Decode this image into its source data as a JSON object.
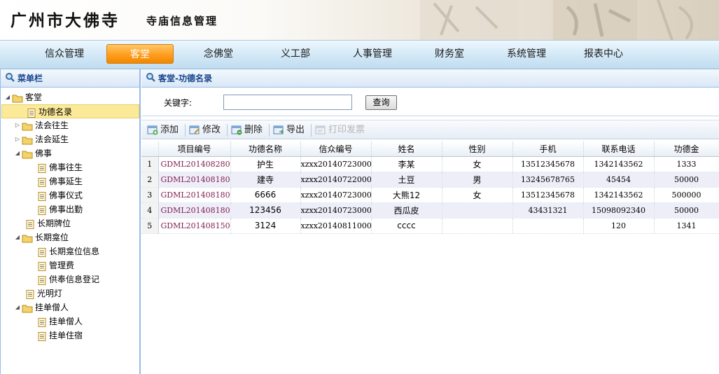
{
  "header": {
    "title": "广州市大佛寺",
    "subtitle": "寺庙信息管理"
  },
  "nav": {
    "items": [
      {
        "label": "信众管理",
        "active": false
      },
      {
        "label": "客堂",
        "active": true
      },
      {
        "label": "念佛堂",
        "active": false
      },
      {
        "label": "义工部",
        "active": false
      },
      {
        "label": "人事管理",
        "active": false
      },
      {
        "label": "财务室",
        "active": false
      },
      {
        "label": "系统管理",
        "active": false
      },
      {
        "label": "报表中心",
        "active": false
      }
    ]
  },
  "sidebar": {
    "title": "菜单栏",
    "tree": [
      {
        "label": "客堂",
        "type": "folder",
        "expanded": true,
        "level": 0
      },
      {
        "label": "功德名录",
        "type": "page",
        "level": 1,
        "selected": true
      },
      {
        "label": "法会往生",
        "type": "folder",
        "expanded": false,
        "level": 1
      },
      {
        "label": "法会延生",
        "type": "folder",
        "expanded": false,
        "level": 1
      },
      {
        "label": "佛事",
        "type": "folder",
        "expanded": true,
        "level": 1
      },
      {
        "label": "佛事往生",
        "type": "page",
        "level": 2
      },
      {
        "label": "佛事延生",
        "type": "page",
        "level": 2
      },
      {
        "label": "佛事仪式",
        "type": "page",
        "level": 2
      },
      {
        "label": "佛事出勤",
        "type": "page",
        "level": 2
      },
      {
        "label": "长期牌位",
        "type": "page",
        "level": 1
      },
      {
        "label": "长期龛位",
        "type": "folder",
        "expanded": true,
        "level": 1
      },
      {
        "label": "长期龛位信息",
        "type": "page",
        "level": 2
      },
      {
        "label": "管理费",
        "type": "page",
        "level": 2
      },
      {
        "label": "供奉信息登记",
        "type": "page",
        "level": 2
      },
      {
        "label": "光明灯",
        "type": "page",
        "level": 1
      },
      {
        "label": "挂单僧人",
        "type": "folder",
        "expanded": true,
        "level": 1
      },
      {
        "label": "挂单僧人",
        "type": "page",
        "level": 2
      },
      {
        "label": "挂单住宿",
        "type": "page",
        "level": 2
      }
    ]
  },
  "main": {
    "title": "客堂-功德名录",
    "search": {
      "label": "关键字:",
      "value": "",
      "button_label": "查询"
    },
    "toolbar": [
      {
        "label": "添加",
        "icon": "add-icon",
        "disabled": false
      },
      {
        "label": "修改",
        "icon": "edit-icon",
        "disabled": false
      },
      {
        "label": "删除",
        "icon": "delete-icon",
        "disabled": false
      },
      {
        "label": "导出",
        "icon": "export-icon",
        "disabled": false
      },
      {
        "label": "打印发票",
        "icon": "print-icon",
        "disabled": true
      }
    ],
    "table": {
      "columns": [
        "",
        "项目编号",
        "功德名称",
        "信众编号",
        "姓名",
        "性别",
        "手机",
        "联系电话",
        "功德金"
      ],
      "rows": [
        [
          "1",
          "GDML2014082800",
          "护生",
          "xzxx201407230000",
          "李某",
          "女",
          "13512345678",
          "1342143562",
          "1333"
        ],
        [
          "2",
          "GDML2014081800",
          "建寺",
          "xzxx201407220000",
          "土豆",
          "男",
          "13245678765",
          "45454",
          "50000"
        ],
        [
          "3",
          "GDML2014081800",
          "6666",
          "xzxx201407230000",
          "大熊12",
          "女",
          "13512345678",
          "1342143562",
          "500000"
        ],
        [
          "4",
          "GDML2014081800",
          "123456",
          "xzxx201407230000",
          "西瓜皮",
          "",
          "43431321",
          "15098092340",
          "50000"
        ],
        [
          "5",
          "GDML2014081500",
          "3124",
          "xzxx201408110000",
          "cccc",
          "",
          "",
          "120",
          "1341"
        ]
      ]
    }
  }
}
